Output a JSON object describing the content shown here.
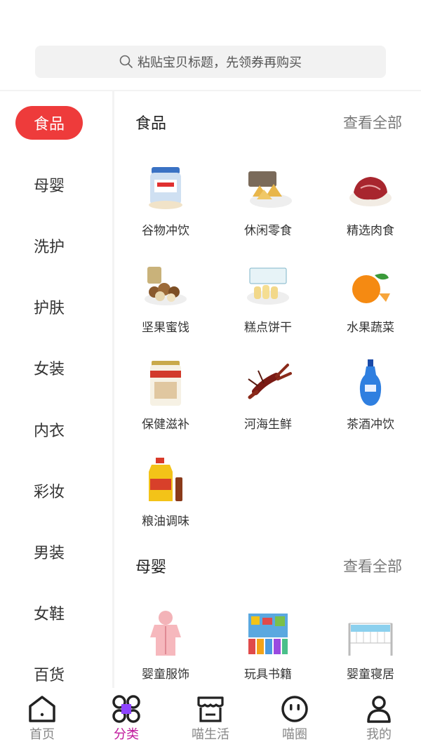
{
  "search": {
    "placeholder": "粘贴宝贝标题，先领券再购买"
  },
  "sidebar": {
    "items": [
      {
        "label": "食品",
        "active": true
      },
      {
        "label": "母婴"
      },
      {
        "label": "洗护"
      },
      {
        "label": "护肤"
      },
      {
        "label": "女装"
      },
      {
        "label": "内衣"
      },
      {
        "label": "彩妆"
      },
      {
        "label": "男装"
      },
      {
        "label": "女鞋"
      },
      {
        "label": "百货"
      }
    ]
  },
  "sections": [
    {
      "title": "食品",
      "more": "查看全部",
      "items": [
        {
          "label": "谷物冲饮",
          "icon": "cereal-drink-icon"
        },
        {
          "label": "休闲零食",
          "icon": "snack-icon"
        },
        {
          "label": "精选肉食",
          "icon": "meat-icon"
        },
        {
          "label": "坚果蜜饯",
          "icon": "nuts-icon"
        },
        {
          "label": "糕点饼干",
          "icon": "pastry-icon"
        },
        {
          "label": "水果蔬菜",
          "icon": "orange-icon"
        },
        {
          "label": "保健滋补",
          "icon": "supplement-can-icon"
        },
        {
          "label": "河海生鲜",
          "icon": "lobster-icon"
        },
        {
          "label": "茶酒冲饮",
          "icon": "liquor-bottle-icon"
        },
        {
          "label": "粮油调味",
          "icon": "oil-bottle-icon"
        }
      ]
    },
    {
      "title": "母婴",
      "more": "查看全部",
      "items": [
        {
          "label": "婴童服饰",
          "icon": "baby-clothes-icon"
        },
        {
          "label": "玩具书籍",
          "icon": "toy-books-icon"
        },
        {
          "label": "婴童寝居",
          "icon": "crib-icon"
        }
      ]
    }
  ],
  "tabbar": {
    "items": [
      {
        "label": "首页",
        "icon": "home-icon"
      },
      {
        "label": "分类",
        "icon": "category-icon",
        "active": true
      },
      {
        "label": "喵生活",
        "icon": "shop-icon"
      },
      {
        "label": "喵圈",
        "icon": "face-icon"
      },
      {
        "label": "我的",
        "icon": "person-icon"
      }
    ]
  },
  "colors": {
    "accent_red": "#ee3b3b",
    "tab_active": "#c0189c"
  }
}
